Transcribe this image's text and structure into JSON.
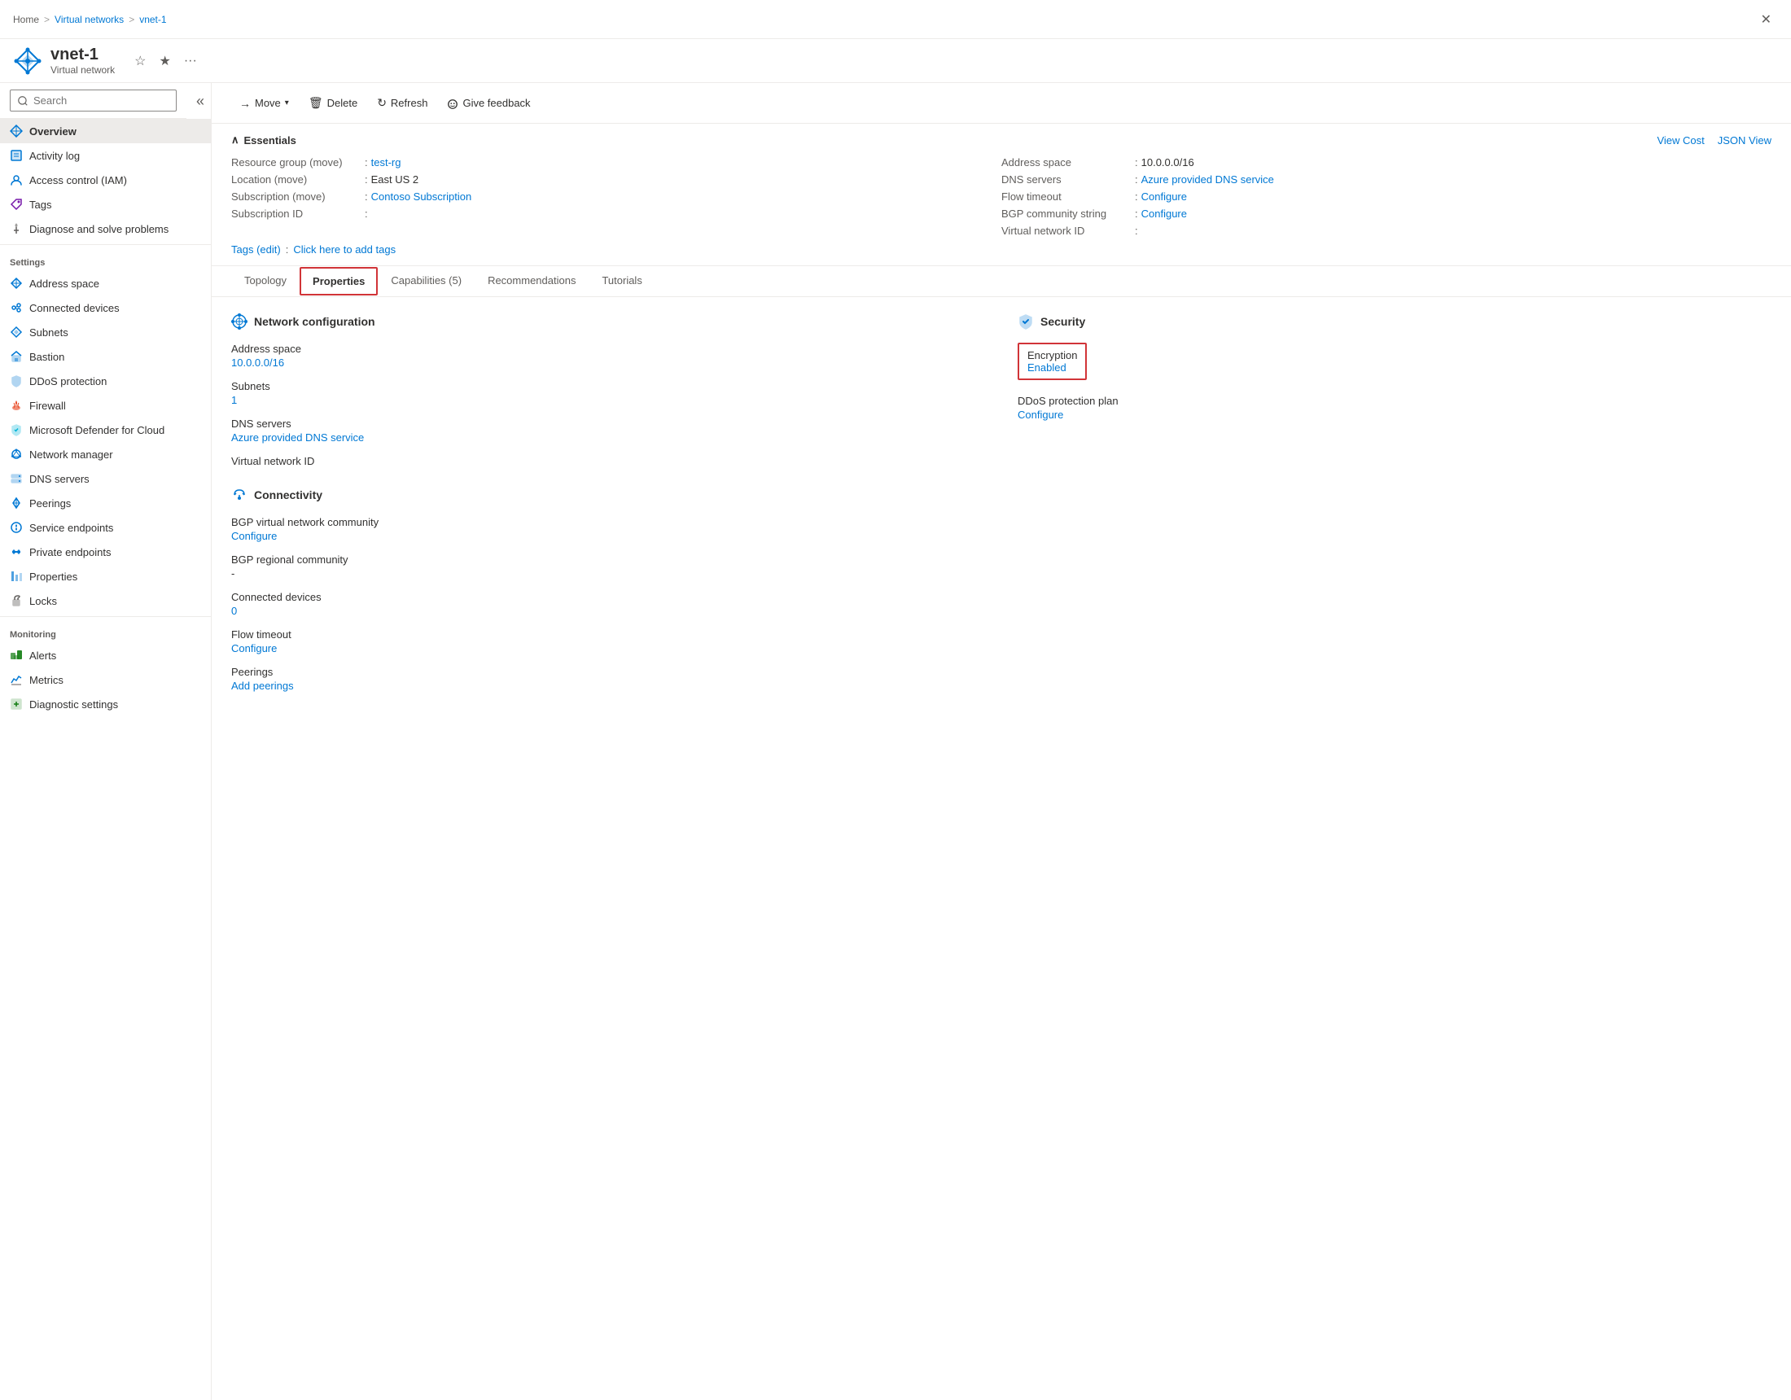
{
  "breadcrumb": {
    "home": "Home",
    "separator1": ">",
    "virtualNetworks": "Virtual networks",
    "separator2": ">",
    "current": "vnet-1"
  },
  "resource": {
    "name": "vnet-1",
    "type": "Virtual network"
  },
  "toolbar": {
    "move_label": "Move",
    "delete_label": "Delete",
    "refresh_label": "Refresh",
    "feedback_label": "Give feedback"
  },
  "essentials": {
    "title": "Essentials",
    "view_cost": "View Cost",
    "json_view": "JSON View",
    "resource_group_label": "Resource group (move)",
    "resource_group_link": "test-rg",
    "location_label": "Location (move)",
    "location_value": "East US 2",
    "subscription_label": "Subscription (move)",
    "subscription_link": "Contoso Subscription",
    "subscription_id_label": "Subscription ID",
    "subscription_id_value": "",
    "address_space_label": "Address space",
    "address_space_value": "10.0.0.0/16",
    "dns_servers_label": "DNS servers",
    "dns_servers_link": "Azure provided DNS service",
    "flow_timeout_label": "Flow timeout",
    "flow_timeout_link": "Configure",
    "bgp_community_label": "BGP community string",
    "bgp_community_link": "Configure",
    "virtual_network_id_label": "Virtual network ID",
    "virtual_network_id_value": "",
    "tags_label": "Tags (edit)",
    "tags_link": "Click here to add tags"
  },
  "tabs": [
    {
      "id": "topology",
      "label": "Topology"
    },
    {
      "id": "properties",
      "label": "Properties",
      "active": true,
      "highlighted": true
    },
    {
      "id": "capabilities",
      "label": "Capabilities (5)"
    },
    {
      "id": "recommendations",
      "label": "Recommendations"
    },
    {
      "id": "tutorials",
      "label": "Tutorials"
    }
  ],
  "properties": {
    "network_config_title": "Network configuration",
    "address_space_label": "Address space",
    "address_space_value": "10.0.0.0/16",
    "subnets_label": "Subnets",
    "subnets_value": "1",
    "dns_servers_label": "DNS servers",
    "dns_servers_value": "Azure provided DNS service",
    "virtual_network_id_label": "Virtual network ID",
    "virtual_network_id_value": "",
    "security_title": "Security",
    "encryption_label": "Encryption",
    "encryption_value": "Enabled",
    "ddos_label": "DDoS protection plan",
    "ddos_value": "Configure",
    "connectivity_title": "Connectivity",
    "bgp_community_label": "BGP virtual network community",
    "bgp_community_value": "Configure",
    "bgp_regional_label": "BGP regional community",
    "bgp_regional_value": "-",
    "connected_devices_label": "Connected devices",
    "connected_devices_value": "0",
    "flow_timeout_label": "Flow timeout",
    "flow_timeout_value": "Configure",
    "peerings_label": "Peerings",
    "peerings_value": "Add peerings"
  },
  "sidebar": {
    "search_placeholder": "Search",
    "items_main": [
      {
        "id": "overview",
        "label": "Overview",
        "active": true
      },
      {
        "id": "activity-log",
        "label": "Activity log"
      },
      {
        "id": "access-control",
        "label": "Access control (IAM)"
      },
      {
        "id": "tags",
        "label": "Tags"
      },
      {
        "id": "diagnose",
        "label": "Diagnose and solve problems"
      }
    ],
    "section_settings": "Settings",
    "items_settings": [
      {
        "id": "address-space",
        "label": "Address space"
      },
      {
        "id": "connected-devices",
        "label": "Connected devices"
      },
      {
        "id": "subnets",
        "label": "Subnets"
      },
      {
        "id": "bastion",
        "label": "Bastion"
      },
      {
        "id": "ddos-protection",
        "label": "DDoS protection"
      },
      {
        "id": "firewall",
        "label": "Firewall"
      },
      {
        "id": "defender-for-cloud",
        "label": "Microsoft Defender for Cloud"
      },
      {
        "id": "network-manager",
        "label": "Network manager"
      },
      {
        "id": "dns-servers",
        "label": "DNS servers"
      },
      {
        "id": "peerings",
        "label": "Peerings"
      },
      {
        "id": "service-endpoints",
        "label": "Service endpoints"
      },
      {
        "id": "private-endpoints",
        "label": "Private endpoints"
      },
      {
        "id": "properties",
        "label": "Properties"
      },
      {
        "id": "locks",
        "label": "Locks"
      }
    ],
    "section_monitoring": "Monitoring",
    "items_monitoring": [
      {
        "id": "alerts",
        "label": "Alerts"
      },
      {
        "id": "metrics",
        "label": "Metrics"
      },
      {
        "id": "diagnostic-settings",
        "label": "Diagnostic settings"
      }
    ]
  }
}
